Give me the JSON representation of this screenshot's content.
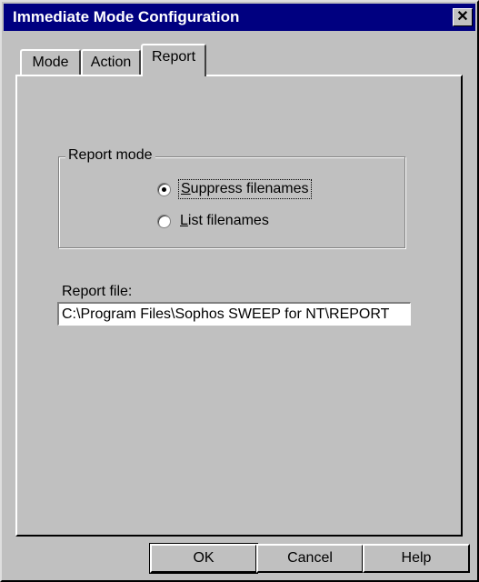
{
  "window": {
    "title": "Immediate Mode Configuration",
    "close_label": "✕"
  },
  "tabs": [
    {
      "label": "Mode"
    },
    {
      "label": "Action"
    },
    {
      "label": "Report"
    }
  ],
  "report_mode": {
    "group_label": "Report mode",
    "options": [
      {
        "label_first": "S",
        "label_rest": "uppress filenames",
        "selected": true
      },
      {
        "label_first": "L",
        "label_rest": "ist filenames",
        "selected": false
      }
    ]
  },
  "report_file": {
    "label": "Report file:",
    "value": "C:\\Program Files\\Sophos SWEEP for NT\\REPORT"
  },
  "buttons": {
    "ok": "OK",
    "cancel": "Cancel",
    "help": "Help"
  }
}
